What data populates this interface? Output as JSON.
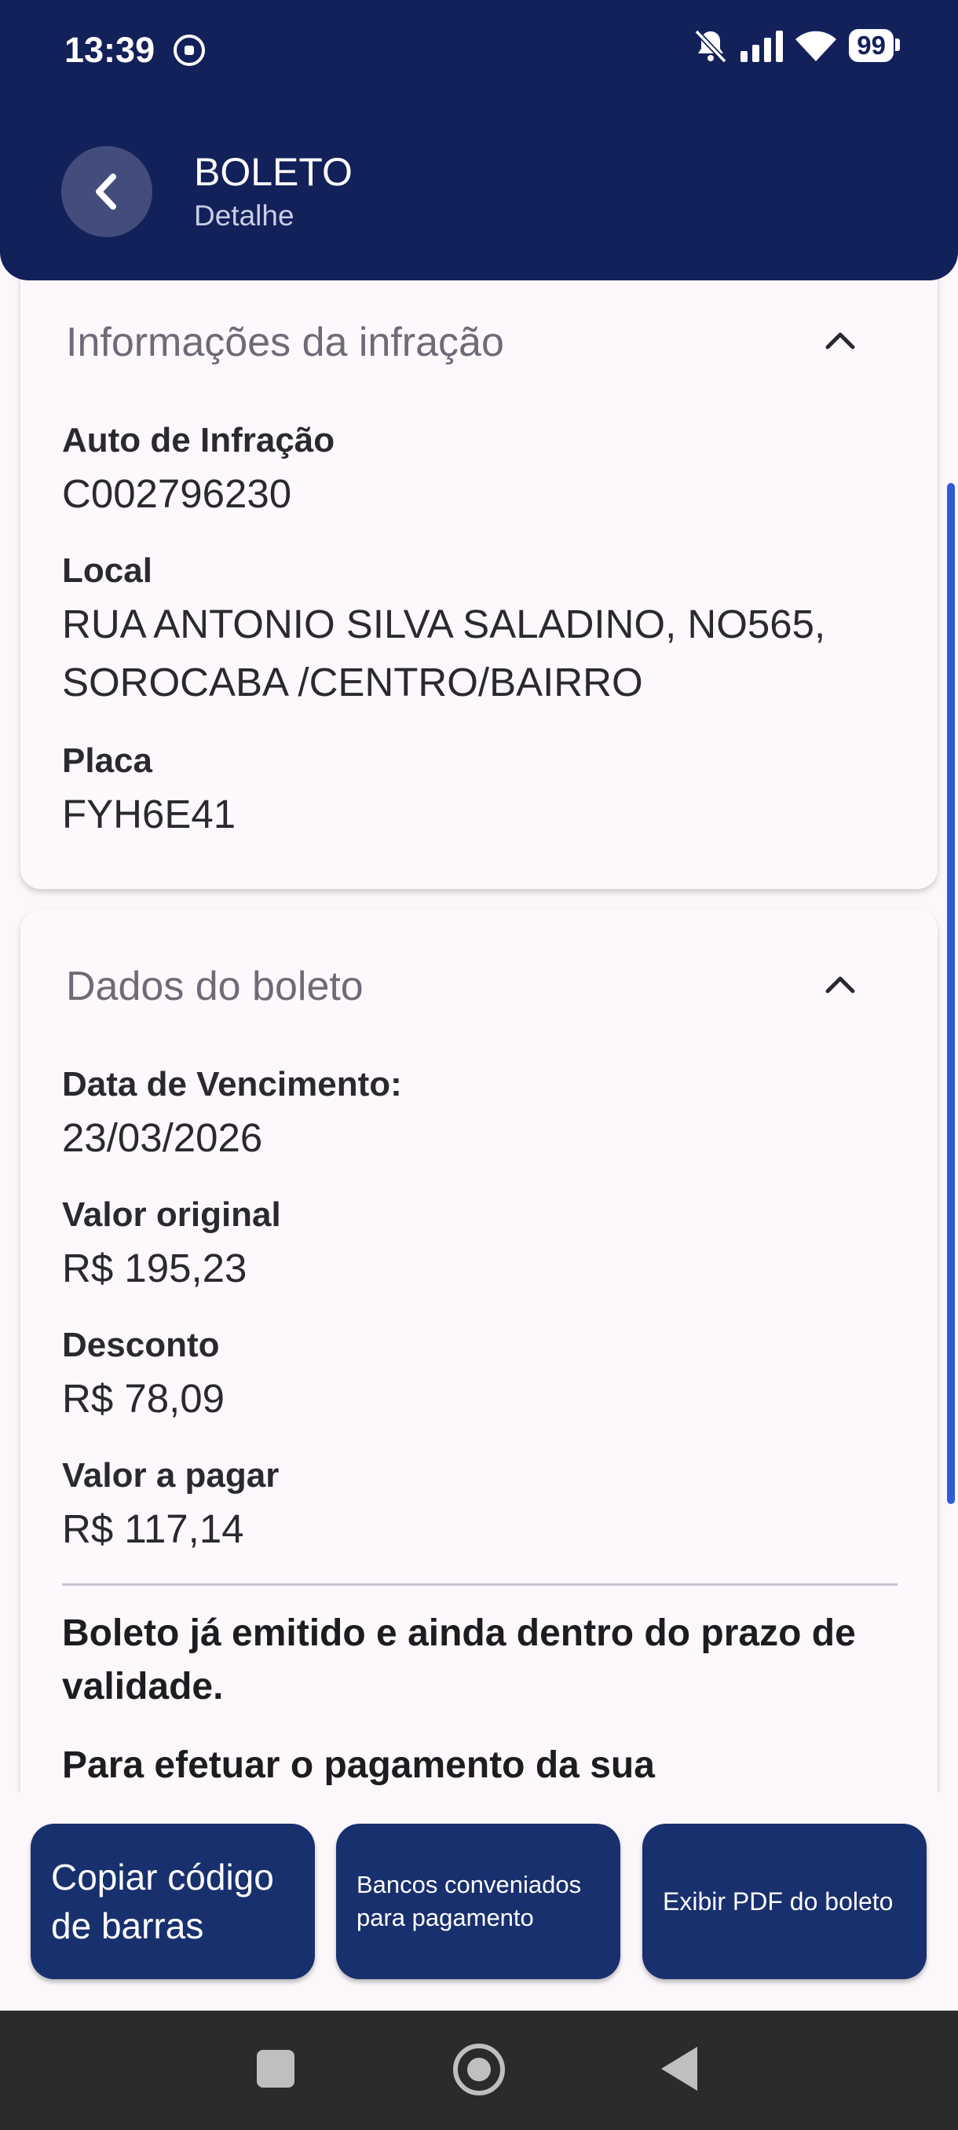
{
  "status_bar": {
    "time": "13:39",
    "battery": "99"
  },
  "header": {
    "title": "BOLETO",
    "subtitle": "Detalhe"
  },
  "infracao": {
    "heading": "Informações da infração",
    "fields": [
      {
        "label": "Auto de Infração",
        "value": "C002796230"
      },
      {
        "label": "Local",
        "value": "RUA ANTONIO SILVA SALADINO, NO565, SOROCABA /CENTRO/BAIRRO"
      },
      {
        "label": "Placa",
        "value": "FYH6E41"
      }
    ]
  },
  "boleto": {
    "heading": "Dados do boleto",
    "fields": [
      {
        "label": "Data de Vencimento:",
        "value": "23/03/2026"
      },
      {
        "label": "Valor original",
        "value": "R$ 195,23"
      },
      {
        "label": "Desconto",
        "value": "R$ 78,09"
      },
      {
        "label": "Valor a pagar",
        "value": "R$ 117,14"
      }
    ],
    "notice_1": "Boleto já emitido e ainda dentro do prazo de validade.",
    "notice_2": "Para efetuar o pagamento da sua"
  },
  "actions": {
    "copy_barcode": "Copiar código de barras",
    "partner_banks": "Bancos conveniados para pagamento",
    "show_pdf": "Exibir PDF do boleto"
  },
  "colors": {
    "header_bg": "#13215a",
    "button_bg": "#19306e",
    "scrollbar": "#2f5bd9"
  }
}
